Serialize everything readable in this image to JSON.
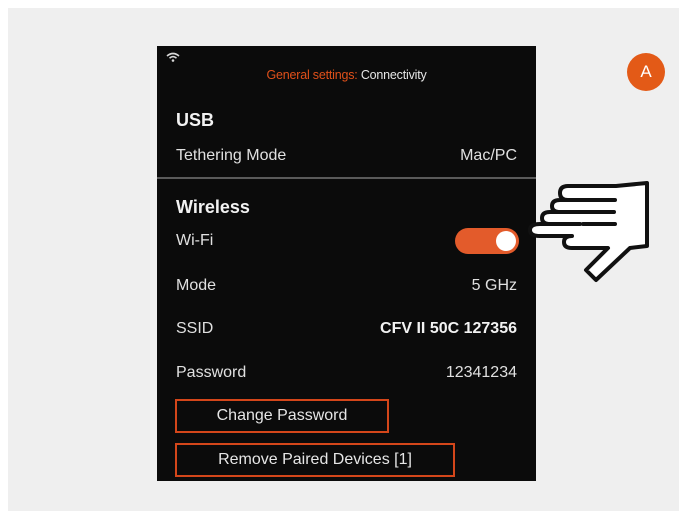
{
  "badge": {
    "label": "A"
  },
  "header": {
    "parent_label": "General settings:",
    "current_label": "Connectivity"
  },
  "usb": {
    "title": "USB",
    "tethering_label": "Tethering Mode",
    "tethering_value": "Mac/PC"
  },
  "wireless": {
    "title": "Wireless",
    "wifi_label": "Wi-Fi",
    "wifi_enabled": true,
    "mode_label": "Mode",
    "mode_value": "5 GHz",
    "ssid_label": "SSID",
    "ssid_value": "CFV II 50C 127356",
    "password_label": "Password",
    "password_value": "12341234"
  },
  "buttons": {
    "change_password": "Change Password",
    "remove_paired": "Remove Paired Devices [1]"
  },
  "colors": {
    "accent": "#e35b2b",
    "screen_bg": "#0b0b0b",
    "panel_bg": "#efefef"
  },
  "icons": {
    "status": "wifi-icon",
    "pointer": "pointing-hand-icon"
  }
}
